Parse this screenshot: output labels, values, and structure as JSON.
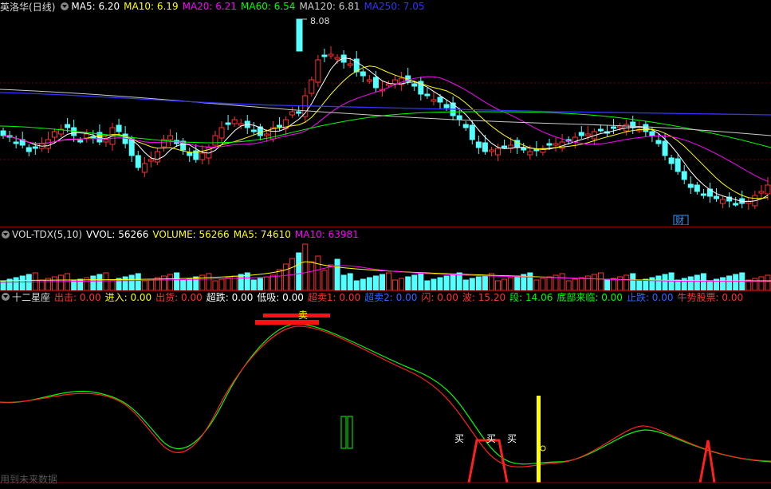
{
  "price_panel": {
    "stock_name": "英洛华",
    "period": "(日线)",
    "ma_labels": [
      {
        "text": "MA5: 6.20",
        "color": "#ffffff"
      },
      {
        "text": "MA10: 6.19",
        "color": "#ffff00"
      },
      {
        "text": "MA20: 6.21",
        "color": "#ff00ff"
      },
      {
        "text": "MA60: 6.54",
        "color": "#00ff00"
      },
      {
        "text": "MA120: 6.81",
        "color": "#cccccc"
      },
      {
        "text": "MA250: 7.05",
        "color": "#3333ff"
      }
    ],
    "high_label": "8.08",
    "event_badge": "财"
  },
  "volume_panel": {
    "labels": [
      {
        "text": "VOL-TDX(5,10)",
        "color": "#dddddd"
      },
      {
        "text": "VVOL: 56266",
        "color": "#ffffff"
      },
      {
        "text": "VOLUME: 56266",
        "color": "#ffff00"
      },
      {
        "text": "MA5: 74610",
        "color": "#ffff00"
      },
      {
        "text": "MA10: 63981",
        "color": "#ff00ff"
      }
    ]
  },
  "indicator_panel": {
    "labels": [
      {
        "text": "十二星座",
        "color": "#dddddd"
      },
      {
        "text": "出击: 0.00",
        "color": "#ff3333"
      },
      {
        "text": "进入: 0.00",
        "color": "#ffff00"
      },
      {
        "text": "出货: 0.00",
        "color": "#ff3333"
      },
      {
        "text": "超跌: 0.00",
        "color": "#ffffff"
      },
      {
        "text": "低吸: 0.00",
        "color": "#ffffff"
      },
      {
        "text": "超卖1: 0.00",
        "color": "#ff3333"
      },
      {
        "text": "超卖2: 0.00",
        "color": "#3366ff"
      },
      {
        "text": "闪: 0.00",
        "color": "#ff3333"
      },
      {
        "text": "波: 15.20",
        "color": "#ff3333"
      },
      {
        "text": "段: 14.06",
        "color": "#00ff00"
      },
      {
        "text": "底部来临: 0.00",
        "color": "#00ff00"
      },
      {
        "text": "止跌: 0.00",
        "color": "#3366ff"
      },
      {
        "text": "牛势股票: 0.00",
        "color": "#ff3333"
      }
    ],
    "sell_label": "卖",
    "buy_labels": [
      "买",
      "买",
      "买"
    ],
    "footer_text": "用到未来数据"
  },
  "chart_data": {
    "type": "candlestick",
    "title": "英洛华 (日线)",
    "high_price": 8.08,
    "note": "Panels: price candles with MAs, volume bars, 十二星座 oscillator"
  }
}
